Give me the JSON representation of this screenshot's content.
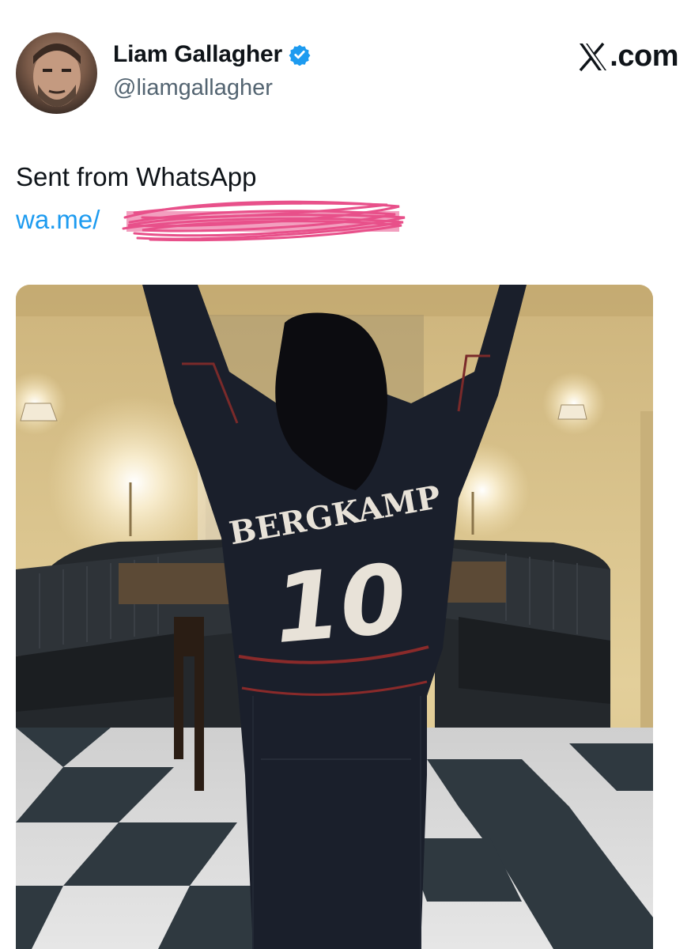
{
  "author": {
    "display_name": "Liam Gallagher",
    "handle": "@liamgallagher",
    "verified": true,
    "avatar_icon": "profile-avatar"
  },
  "brand": {
    "label": ".com",
    "icon": "x-logo-icon"
  },
  "tweet": {
    "text": "Sent from WhatsApp",
    "link_text": "wa.me/"
  },
  "media": {
    "jersey_name": "BERGKAMP",
    "jersey_number": "10"
  },
  "colors": {
    "link": "#1d9bf0",
    "verified": "#1d9bf0",
    "handle": "#536471",
    "scribble": "#e8508a"
  }
}
